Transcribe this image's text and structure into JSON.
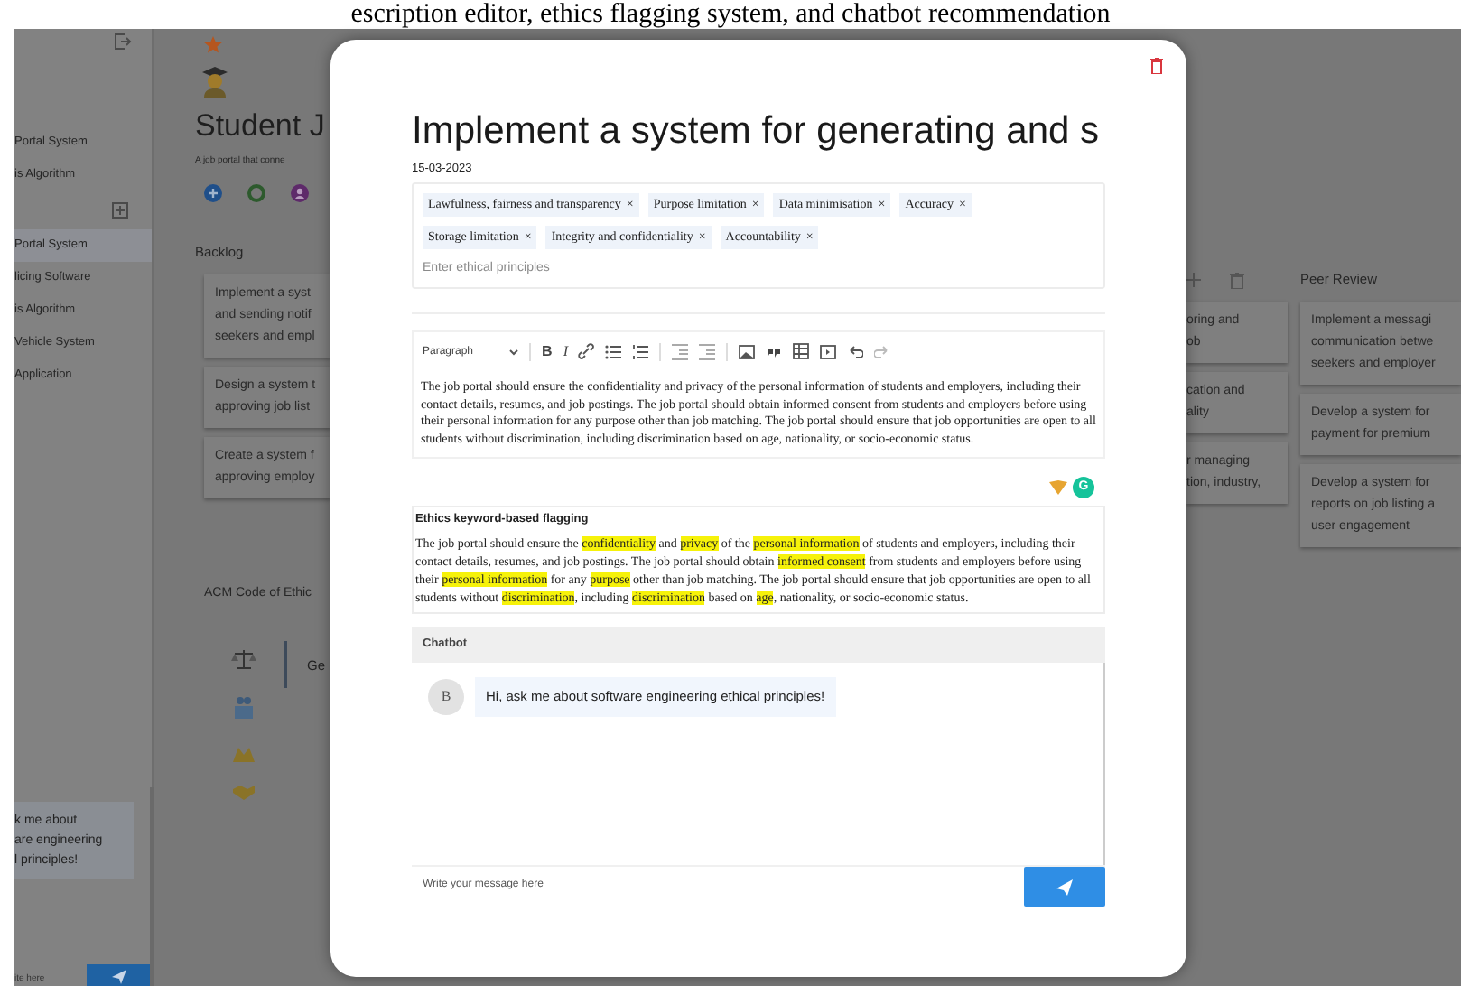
{
  "caption": "escription editor, ethics flagging system, and chatbot recommendation",
  "sidebar": {
    "top_items": [
      "Portal System",
      "is Algorithm"
    ],
    "projects": [
      {
        "label": "Portal System",
        "selected": true
      },
      {
        "label": "licing Software",
        "selected": false
      },
      {
        "label": "is Algorithm",
        "selected": false
      },
      {
        "label": "Vehicle System",
        "selected": false
      },
      {
        "label": "Application",
        "selected": false
      }
    ],
    "chat": {
      "message_lines": [
        "k me about",
        "are engineering",
        "l principles!"
      ],
      "placeholder": "ite here"
    }
  },
  "project": {
    "title": "Student J",
    "description": "A job portal that conne",
    "backlog": {
      "title": "Backlog",
      "cards": [
        [
          "Implement a syst",
          "and sending notif",
          "seekers and empl"
        ],
        [
          "Design a system t",
          "approving job list"
        ],
        [
          "Create a system f",
          "approving employ"
        ]
      ]
    },
    "column_3": {
      "cards": [
        [
          "oring and",
          "ob"
        ],
        [
          "cation and",
          "ality"
        ],
        [
          "r managing",
          "tion, industry,"
        ]
      ]
    },
    "peer_review": {
      "title": "Peer Review",
      "cards": [
        [
          "Implement a messagi",
          "communication betwe",
          "seekers and employer"
        ],
        [
          "Develop a system for",
          "payment for premium"
        ],
        [
          "Develop a system for",
          "reports on job listing a",
          "user engagement"
        ]
      ]
    },
    "ethics": {
      "title": "ACM Code of Ethic",
      "tab": "Ge"
    }
  },
  "modal": {
    "title": "Implement a system for generating and s",
    "date": "15-03-2023",
    "tags": [
      "Lawfulness, fairness and transparency",
      "Purpose limitation",
      "Data minimisation",
      "Accuracy",
      "Storage limitation",
      "Integrity and confidentiality",
      "Accountability"
    ],
    "tag_remove": "×",
    "tag_placeholder": "Enter ethical principles",
    "editor": {
      "block_style": "Paragraph",
      "bold": "B",
      "italic": "I",
      "text": "The job portal should ensure the confidentiality and privacy of the personal information of students and employers, including their contact details, resumes, and job postings. The job portal should obtain informed consent from students and employers before using their personal information for any purpose other than job matching. The job portal should ensure that job opportunities are open to all students without discrimination, including discrimination based on age, nationality, or socio-economic status.",
      "grammar_badge": "G"
    },
    "flagging": {
      "title": "Ethics keyword-based flagging",
      "segments": [
        {
          "text": "The job portal should ensure the ",
          "flagged": false
        },
        {
          "text": "confidentiality",
          "flagged": true
        },
        {
          "text": " and ",
          "flagged": false
        },
        {
          "text": "privacy",
          "flagged": true
        },
        {
          "text": " of the ",
          "flagged": false
        },
        {
          "text": "personal information",
          "flagged": true
        },
        {
          "text": " of students and employers, including their contact details, resumes, and job postings. The job portal should obtain ",
          "flagged": false
        },
        {
          "text": "informed consent",
          "flagged": true
        },
        {
          "text": " from students and employers before using their ",
          "flagged": false
        },
        {
          "text": "personal information",
          "flagged": true
        },
        {
          "text": " for any ",
          "flagged": false
        },
        {
          "text": "purpose",
          "flagged": true
        },
        {
          "text": " other than job matching. The job portal should ensure that job opportunities are open to all students without ",
          "flagged": false
        },
        {
          "text": "discrimination",
          "flagged": true
        },
        {
          "text": ", including ",
          "flagged": false
        },
        {
          "text": "discrimination",
          "flagged": true
        },
        {
          "text": " based on ",
          "flagged": false
        },
        {
          "text": "age",
          "flagged": true
        },
        {
          "text": ", nationality, or socio-economic status.",
          "flagged": false
        }
      ]
    },
    "chatbot": {
      "title": "Chatbot",
      "messages": [
        {
          "avatar": "B",
          "text": "Hi, ask me about software engineering ethical principles!"
        }
      ],
      "placeholder": "Write your message here"
    }
  }
}
